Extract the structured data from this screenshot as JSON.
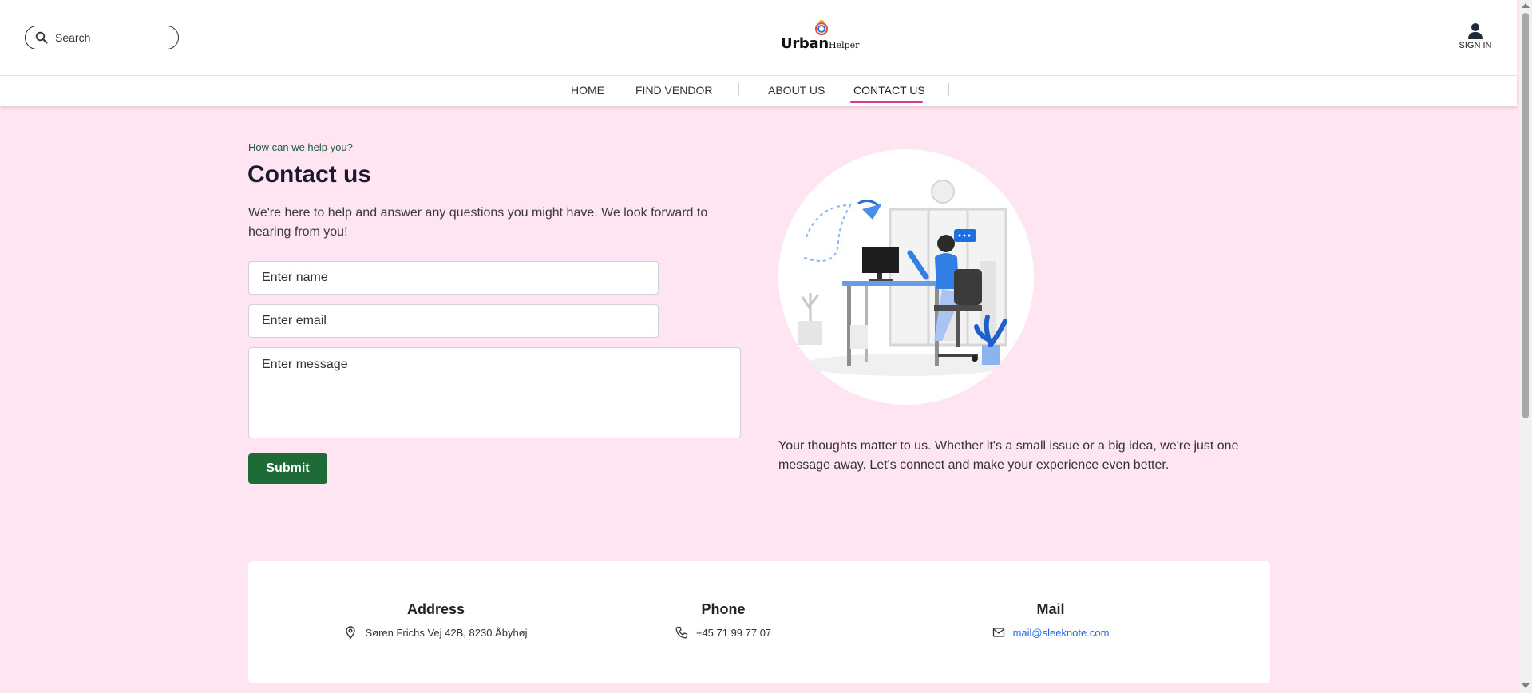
{
  "header": {
    "search_placeholder": "Search",
    "brand_main": "Urban",
    "brand_sub": "Helper",
    "signin_label": "SIGN IN"
  },
  "nav": {
    "items": [
      {
        "label": "HOME"
      },
      {
        "label": "FIND VENDOR"
      },
      {
        "label": "ABOUT US"
      },
      {
        "label": "CONTACT US",
        "active": true
      }
    ]
  },
  "contact": {
    "eyebrow": "How can we help you?",
    "title": "Contact us",
    "intro": "We're here to help and answer any questions you might have. We look forward to hearing from you!",
    "name_placeholder": "Enter name",
    "email_placeholder": "Enter email",
    "message_placeholder": "Enter message",
    "submit_label": "Submit",
    "side_text": "Your thoughts matter to us. Whether it's a small issue or a big idea, we're just one message away. Let's connect and make your experience even better."
  },
  "info": {
    "address_title": "Address",
    "address_value": "Søren Frichs Vej 42B, 8230 Åbyhøj",
    "phone_title": "Phone",
    "phone_value": "+45 71 99 77 07",
    "mail_title": "Mail",
    "mail_value": "mail@sleeknote.com"
  },
  "colors": {
    "page_bg": "#ffe4f1",
    "accent_pink": "#d63c8f",
    "submit_green": "#1e6b37",
    "link_blue": "#2563eb"
  },
  "icons": [
    "search-icon",
    "logo-icon",
    "user-icon",
    "location-pin-icon",
    "phone-icon",
    "mail-icon"
  ]
}
